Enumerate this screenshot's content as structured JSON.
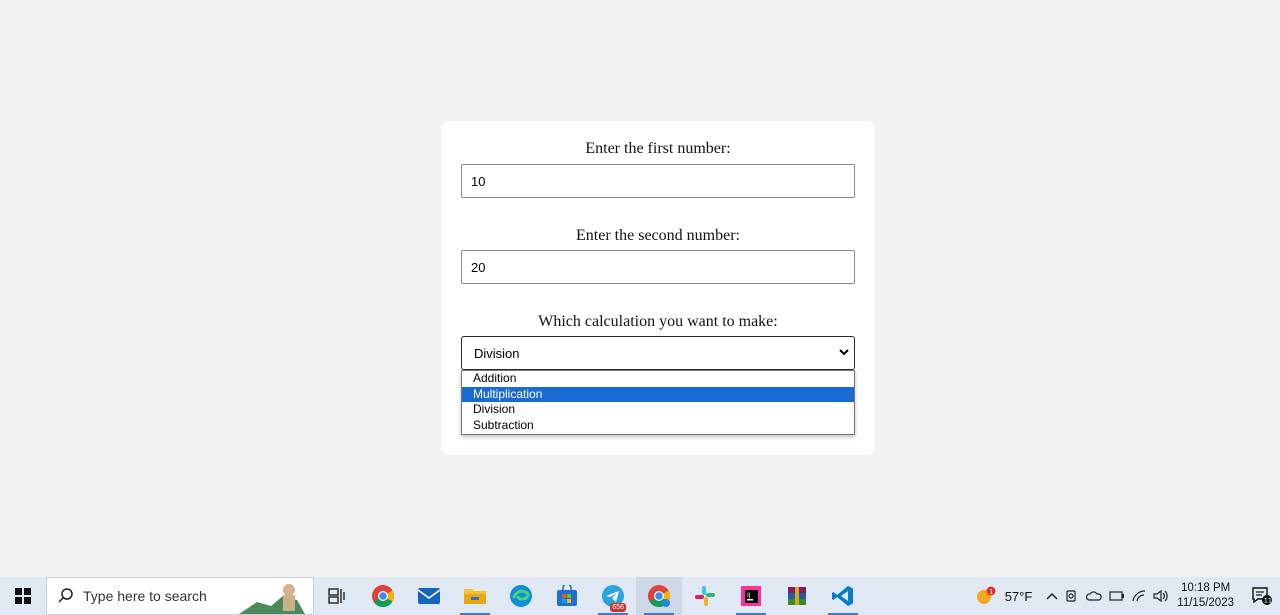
{
  "form": {
    "first_label": "Enter the first number:",
    "first_value": "10",
    "second_label": "Enter the second number:",
    "second_value": "20",
    "calc_label": "Which calculation you want to make:",
    "selected": "Division",
    "options": [
      "Addition",
      "Multiplication",
      "Division",
      "Subtraction"
    ],
    "highlighted_option": "Multiplication"
  },
  "colors": {
    "page_bg": "#f2f2f2",
    "card_bg": "#ffffff",
    "highlight": "#1a6ad4",
    "taskbar_bg": "#dfe8f3"
  },
  "taskbar": {
    "search_placeholder": "Type here to search",
    "apps": [
      "task-view-icon",
      "chrome-icon",
      "mail-icon",
      "file-explorer-icon",
      "edge-icon",
      "microsoft-store-icon",
      "telegram-icon",
      "chrome-profile-icon",
      "slack-icon",
      "jetbrains-icon",
      "winrar-icon",
      "vscode-icon"
    ],
    "telegram_badge": "656",
    "weather_temp": "57°F",
    "weather_alert": "1",
    "time": "10:18 PM",
    "date": "11/15/2023",
    "notification_count": "11"
  }
}
